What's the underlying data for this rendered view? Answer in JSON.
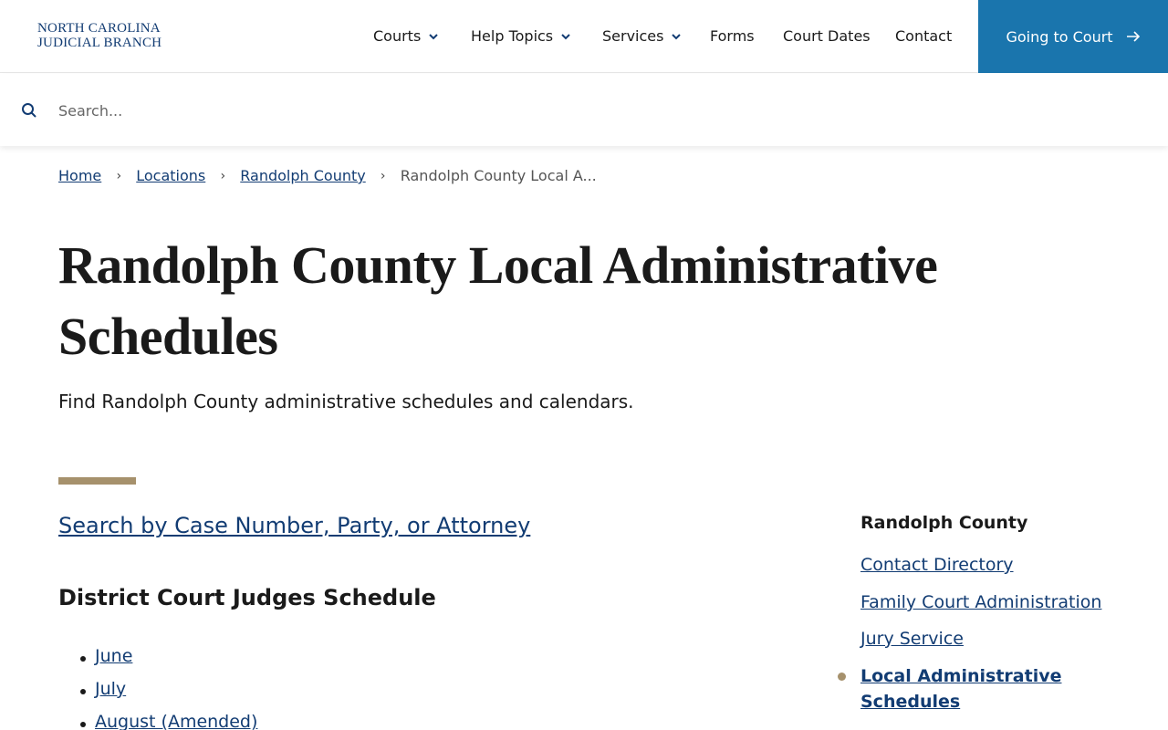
{
  "logo": {
    "line1": "NORTH CAROLINA",
    "line2": "JUDICIAL BRANCH"
  },
  "nav": {
    "items": [
      {
        "label": "Courts",
        "has_dropdown": true
      },
      {
        "label": "Help Topics",
        "has_dropdown": true
      },
      {
        "label": "Services",
        "has_dropdown": true
      },
      {
        "label": "Forms",
        "has_dropdown": false
      },
      {
        "label": "Court Dates",
        "has_dropdown": false
      },
      {
        "label": "Contact",
        "has_dropdown": false
      }
    ],
    "cta_label": "Going to Court"
  },
  "search": {
    "placeholder": "Search...",
    "value": ""
  },
  "breadcrumb": {
    "items": [
      "Home",
      "Locations",
      "Randolph County"
    ],
    "current": "Randolph County Local A..."
  },
  "page": {
    "title": "Randolph County Local Administrative Schedules",
    "subtitle": "Find Randolph County administrative schedules and calendars.",
    "case_search_link": "Search by Case Number, Party, or Attorney",
    "section_heading": "District Court Judges Schedule",
    "months": [
      "June",
      "July",
      "August (Amended)"
    ]
  },
  "sidebar": {
    "title": "Randolph County",
    "links": [
      "Contact Directory",
      "Family Court Administration",
      "Jury Service",
      "Local Administrative Schedules"
    ],
    "active_index": 3
  },
  "colors": {
    "brand_blue": "#123c73",
    "cta_blue": "#1a75ad",
    "accent_tan": "#a6916c"
  },
  "icons": {
    "search": "search-icon",
    "dropdown": "chevron-down-icon",
    "cta": "arrow-right-icon"
  }
}
